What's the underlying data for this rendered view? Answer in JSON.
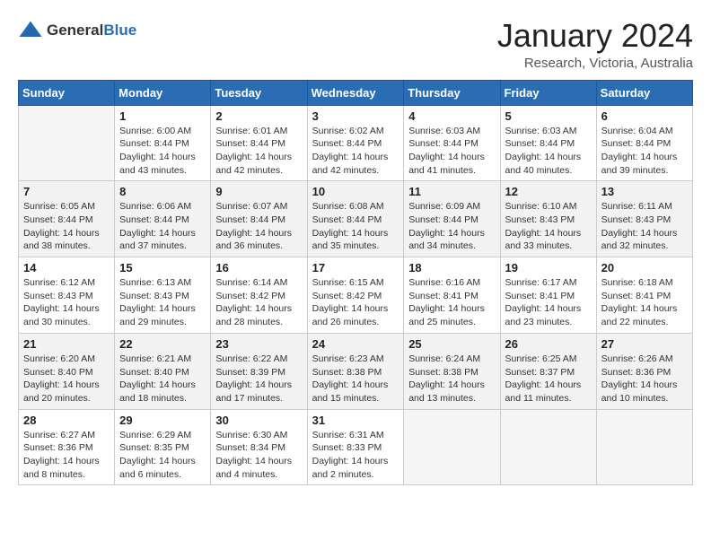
{
  "header": {
    "logo_general": "General",
    "logo_blue": "Blue",
    "title": "January 2024",
    "subtitle": "Research, Victoria, Australia"
  },
  "days_of_week": [
    "Sunday",
    "Monday",
    "Tuesday",
    "Wednesday",
    "Thursday",
    "Friday",
    "Saturday"
  ],
  "weeks": [
    [
      {
        "day": "",
        "info": ""
      },
      {
        "day": "1",
        "info": "Sunrise: 6:00 AM\nSunset: 8:44 PM\nDaylight: 14 hours\nand 43 minutes."
      },
      {
        "day": "2",
        "info": "Sunrise: 6:01 AM\nSunset: 8:44 PM\nDaylight: 14 hours\nand 42 minutes."
      },
      {
        "day": "3",
        "info": "Sunrise: 6:02 AM\nSunset: 8:44 PM\nDaylight: 14 hours\nand 42 minutes."
      },
      {
        "day": "4",
        "info": "Sunrise: 6:03 AM\nSunset: 8:44 PM\nDaylight: 14 hours\nand 41 minutes."
      },
      {
        "day": "5",
        "info": "Sunrise: 6:03 AM\nSunset: 8:44 PM\nDaylight: 14 hours\nand 40 minutes."
      },
      {
        "day": "6",
        "info": "Sunrise: 6:04 AM\nSunset: 8:44 PM\nDaylight: 14 hours\nand 39 minutes."
      }
    ],
    [
      {
        "day": "7",
        "info": "Sunrise: 6:05 AM\nSunset: 8:44 PM\nDaylight: 14 hours\nand 38 minutes."
      },
      {
        "day": "8",
        "info": "Sunrise: 6:06 AM\nSunset: 8:44 PM\nDaylight: 14 hours\nand 37 minutes."
      },
      {
        "day": "9",
        "info": "Sunrise: 6:07 AM\nSunset: 8:44 PM\nDaylight: 14 hours\nand 36 minutes."
      },
      {
        "day": "10",
        "info": "Sunrise: 6:08 AM\nSunset: 8:44 PM\nDaylight: 14 hours\nand 35 minutes."
      },
      {
        "day": "11",
        "info": "Sunrise: 6:09 AM\nSunset: 8:44 PM\nDaylight: 14 hours\nand 34 minutes."
      },
      {
        "day": "12",
        "info": "Sunrise: 6:10 AM\nSunset: 8:43 PM\nDaylight: 14 hours\nand 33 minutes."
      },
      {
        "day": "13",
        "info": "Sunrise: 6:11 AM\nSunset: 8:43 PM\nDaylight: 14 hours\nand 32 minutes."
      }
    ],
    [
      {
        "day": "14",
        "info": "Sunrise: 6:12 AM\nSunset: 8:43 PM\nDaylight: 14 hours\nand 30 minutes."
      },
      {
        "day": "15",
        "info": "Sunrise: 6:13 AM\nSunset: 8:43 PM\nDaylight: 14 hours\nand 29 minutes."
      },
      {
        "day": "16",
        "info": "Sunrise: 6:14 AM\nSunset: 8:42 PM\nDaylight: 14 hours\nand 28 minutes."
      },
      {
        "day": "17",
        "info": "Sunrise: 6:15 AM\nSunset: 8:42 PM\nDaylight: 14 hours\nand 26 minutes."
      },
      {
        "day": "18",
        "info": "Sunrise: 6:16 AM\nSunset: 8:41 PM\nDaylight: 14 hours\nand 25 minutes."
      },
      {
        "day": "19",
        "info": "Sunrise: 6:17 AM\nSunset: 8:41 PM\nDaylight: 14 hours\nand 23 minutes."
      },
      {
        "day": "20",
        "info": "Sunrise: 6:18 AM\nSunset: 8:41 PM\nDaylight: 14 hours\nand 22 minutes."
      }
    ],
    [
      {
        "day": "21",
        "info": "Sunrise: 6:20 AM\nSunset: 8:40 PM\nDaylight: 14 hours\nand 20 minutes."
      },
      {
        "day": "22",
        "info": "Sunrise: 6:21 AM\nSunset: 8:40 PM\nDaylight: 14 hours\nand 18 minutes."
      },
      {
        "day": "23",
        "info": "Sunrise: 6:22 AM\nSunset: 8:39 PM\nDaylight: 14 hours\nand 17 minutes."
      },
      {
        "day": "24",
        "info": "Sunrise: 6:23 AM\nSunset: 8:38 PM\nDaylight: 14 hours\nand 15 minutes."
      },
      {
        "day": "25",
        "info": "Sunrise: 6:24 AM\nSunset: 8:38 PM\nDaylight: 14 hours\nand 13 minutes."
      },
      {
        "day": "26",
        "info": "Sunrise: 6:25 AM\nSunset: 8:37 PM\nDaylight: 14 hours\nand 11 minutes."
      },
      {
        "day": "27",
        "info": "Sunrise: 6:26 AM\nSunset: 8:36 PM\nDaylight: 14 hours\nand 10 minutes."
      }
    ],
    [
      {
        "day": "28",
        "info": "Sunrise: 6:27 AM\nSunset: 8:36 PM\nDaylight: 14 hours\nand 8 minutes."
      },
      {
        "day": "29",
        "info": "Sunrise: 6:29 AM\nSunset: 8:35 PM\nDaylight: 14 hours\nand 6 minutes."
      },
      {
        "day": "30",
        "info": "Sunrise: 6:30 AM\nSunset: 8:34 PM\nDaylight: 14 hours\nand 4 minutes."
      },
      {
        "day": "31",
        "info": "Sunrise: 6:31 AM\nSunset: 8:33 PM\nDaylight: 14 hours\nand 2 minutes."
      },
      {
        "day": "",
        "info": ""
      },
      {
        "day": "",
        "info": ""
      },
      {
        "day": "",
        "info": ""
      }
    ]
  ]
}
